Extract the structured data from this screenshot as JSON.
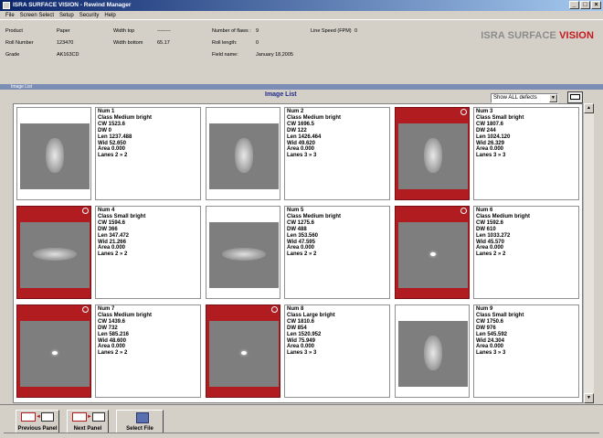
{
  "window": {
    "title": "ISRA SURFACE VISION - Rewind Manager",
    "controls": [
      "_",
      "□",
      "×"
    ]
  },
  "menu": [
    "File",
    "Screen Select",
    "Setup",
    "Security",
    "Help"
  ],
  "info": {
    "product_label": "Product",
    "product_value": "Paper",
    "roll_label": "Roll Number",
    "roll_value": "123470",
    "grade_label": "Grade",
    "grade_value": "AK163CD",
    "width_top_label": "Width top",
    "width_top_value": "--------",
    "width_bottom_label": "Width bottom",
    "width_bottom_value": "65.17",
    "flaws_label": "Number of flaws :",
    "flaws_value": "9",
    "roll_length_label": "Roll length:",
    "roll_length_value": "0",
    "field_name_label": "Field name:",
    "field_name_value": "January 18,2005",
    "line_speed_label": "Line Speed (FPM)",
    "line_speed_value": "0"
  },
  "logo": {
    "part1": "ISRA SURFACE ",
    "part2": "VISION",
    "accent": "#c4161c"
  },
  "image_list": {
    "section_label": "Image List",
    "title": "Image List",
    "filter_value": "Show ALL defects",
    "filter_arrow": "▼"
  },
  "defects": [
    {
      "num": "Num 1",
      "class": "Class Medium bright",
      "cw": "CW 1523.6",
      "dw": "DW 0",
      "len": "Len 1237.488",
      "wid": "Wid 52.650",
      "area": "Area 0.000",
      "lanes": "Lanes 2 » 2",
      "selected": false,
      "shape": "diamond"
    },
    {
      "num": "Num 2",
      "class": "Class Medium bright",
      "cw": "CW 1696.5",
      "dw": "DW 122",
      "len": "Len 1426.464",
      "wid": "Wid 49.620",
      "area": "Area 0.000",
      "lanes": "Lanes 3 » 3",
      "selected": false,
      "shape": "diamond"
    },
    {
      "num": "Num 3",
      "class": "Class Small bright",
      "cw": "CW 1807.6",
      "dw": "DW 244",
      "len": "Len 1024.120",
      "wid": "Wid 26.329",
      "area": "Area 0.000",
      "lanes": "Lanes 3 » 3",
      "selected": true,
      "shape": "diamond"
    },
    {
      "num": "Num 4",
      "class": "Class Small bright",
      "cw": "CW 1594.6",
      "dw": "DW 366",
      "len": "Len 347.472",
      "wid": "Wid 21.266",
      "area": "Area 0.000",
      "lanes": "Lanes 2 » 2",
      "selected": true,
      "shape": "blob"
    },
    {
      "num": "Num 5",
      "class": "Class Medium bright",
      "cw": "CW 1275.6",
      "dw": "DW 488",
      "len": "Len 353.560",
      "wid": "Wid 47.595",
      "area": "Area 0.000",
      "lanes": "Lanes 2 » 2",
      "selected": false,
      "shape": "blob"
    },
    {
      "num": "Num 6",
      "class": "Class Medium bright",
      "cw": "CW 1592.6",
      "dw": "DW 610",
      "len": "Len 1033.272",
      "wid": "Wid 45.570",
      "area": "Area 0.000",
      "lanes": "Lanes 2 » 2",
      "selected": true,
      "shape": "dot"
    },
    {
      "num": "Num 7",
      "class": "Class Medium bright",
      "cw": "CW 1439.6",
      "dw": "DW 732",
      "len": "Len 585.216",
      "wid": "Wid 48.600",
      "area": "Area 0.000",
      "lanes": "Lanes 2 » 2",
      "selected": true,
      "shape": "dot"
    },
    {
      "num": "Num 8",
      "class": "Class Large bright",
      "cw": "CW 1810.6",
      "dw": "DW 854",
      "len": "Len 1520.952",
      "wid": "Wid 75.949",
      "area": "Area 0.000",
      "lanes": "Lanes 3 » 3",
      "selected": true,
      "shape": "dot"
    },
    {
      "num": "Num 9",
      "class": "Class Small bright",
      "cw": "CW 1750.6",
      "dw": "DW 976",
      "len": "Len 545.592",
      "wid": "Wid 24.304",
      "area": "Area 0.000",
      "lanes": "Lanes 3 » 3",
      "selected": false,
      "shape": "diamond"
    }
  ],
  "scroll": {
    "up": "▲",
    "down": "▼"
  },
  "toolbar": {
    "previous_label": "Previous Panel",
    "next_label": "Next Panel",
    "select_file_label": "Select File"
  },
  "colors": {
    "selected_bg": "#b01c1f",
    "title_text": "#1f2a8a",
    "section_bar": "#7b8db5"
  }
}
